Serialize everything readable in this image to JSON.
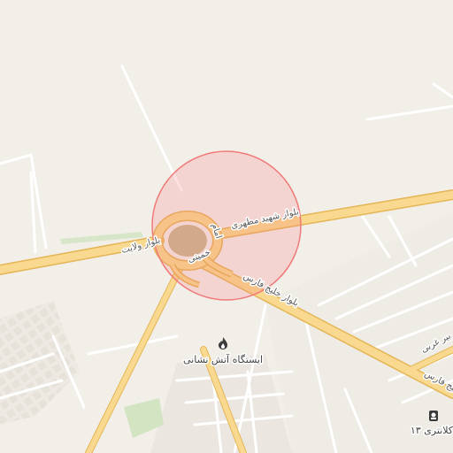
{
  "map": {
    "roads": {
      "velayat": "بلوار ولایت",
      "motahari": "بلوار شهید مطهری",
      "khalij_fars": "بلوار خلیج فارس",
      "khalij_fars_east": "خلیج فارس",
      "imam_khomeini_a": "امام",
      "imam_khomeini_b": "خمینی",
      "gharbi": "غربی",
      "gharbi_prefix": "بیر"
    },
    "pois": {
      "fire_station": "ایستگاه آتش نشانی",
      "police_station": "کلانتری ۱۳"
    },
    "colors": {
      "background": "#f2efe9",
      "road_fill": "#f7d587",
      "road_casing": "#e8b95c",
      "minor_road": "#ffffff",
      "highlight_circle": "#f8b4b4",
      "roundabout": "#c8b88a",
      "park": "#cfe3bd"
    },
    "icons": {
      "fire_station": "fire-icon",
      "police_station": "police-icon"
    }
  }
}
